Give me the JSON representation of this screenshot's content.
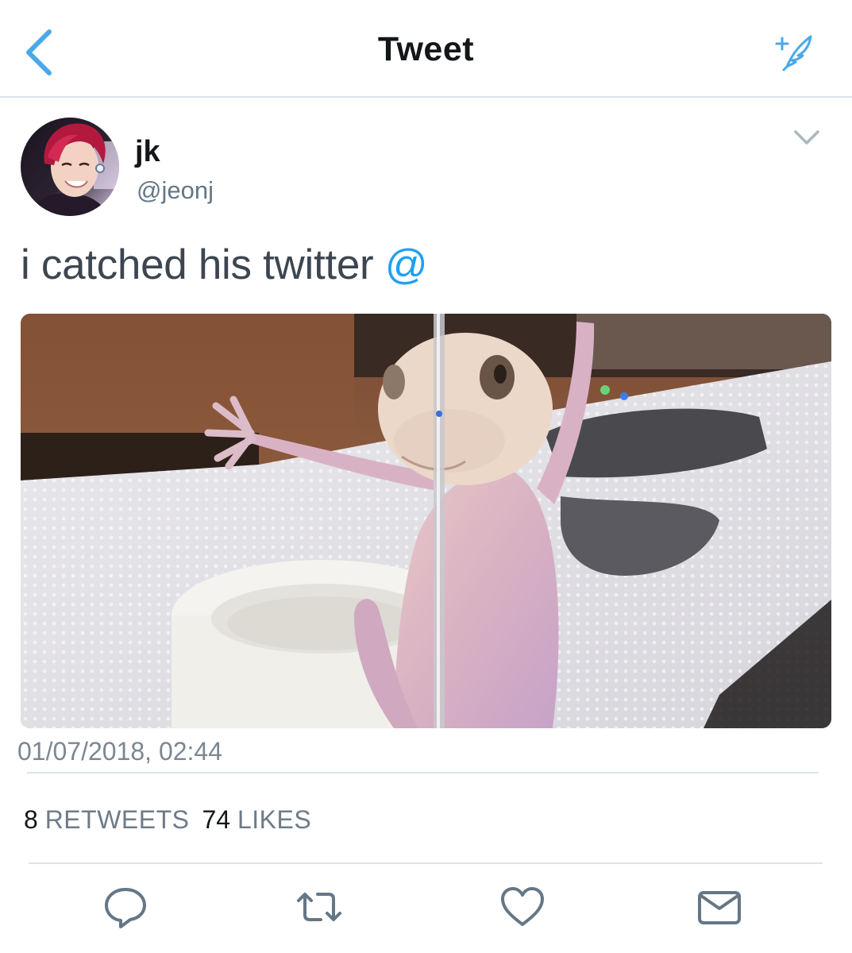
{
  "header": {
    "back_icon": "chevron-left-icon",
    "title": "Tweet",
    "compose_icon": "compose-sparkle-icon"
  },
  "tweet": {
    "author": {
      "display_name": "jk",
      "handle": "@jeonj"
    },
    "text": "i catched his twitter ",
    "mention": "@",
    "timestamp": "01/07/2018, 02:44",
    "stats": {
      "retweets_count": "8",
      "retweets_label": "RETWEETS",
      "likes_count": "74",
      "likes_label": "LIKES"
    },
    "actions": [
      {
        "name": "reply",
        "icon": "reply-bubble-icon"
      },
      {
        "name": "retweet",
        "icon": "retweet-arrows-icon"
      },
      {
        "name": "like",
        "icon": "heart-icon"
      },
      {
        "name": "direct-message",
        "icon": "envelope-icon"
      }
    ]
  },
  "colors": {
    "accent": "#1da1f2",
    "icon_blue": "#4aa8e8",
    "text_primary": "#14171a",
    "text_secondary": "#657786",
    "divider": "#dbe4ec"
  }
}
